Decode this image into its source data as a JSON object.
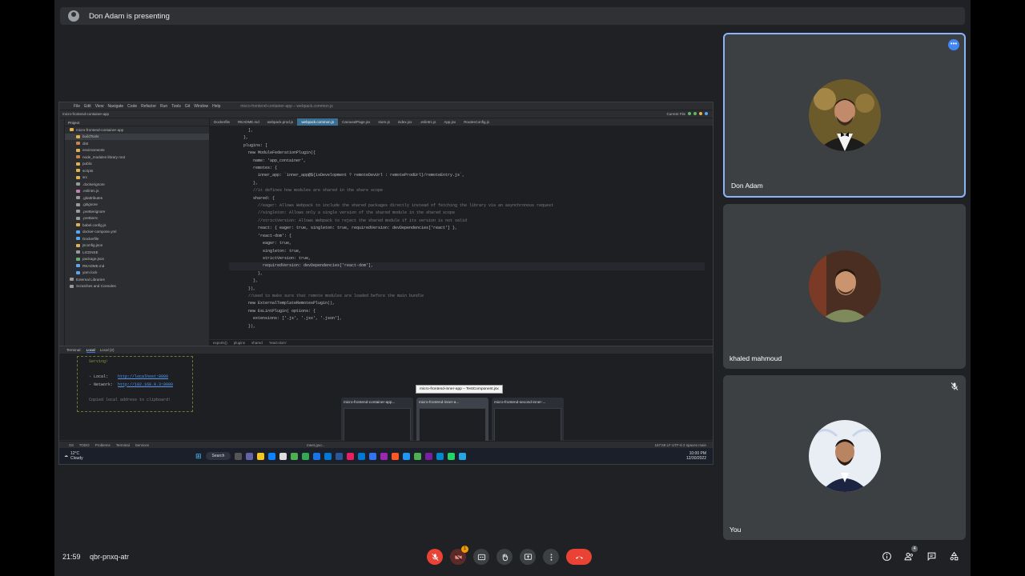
{
  "banner": {
    "text": "Don Adam is presenting"
  },
  "ide": {
    "menu": [
      "File",
      "Edit",
      "View",
      "Navigate",
      "Code",
      "Refactor",
      "Run",
      "Tools",
      "Git",
      "Window",
      "Help"
    ],
    "window_title": "micro-frontend-container-app – webpack.common.js",
    "breadcrumb": "micro-frontend-container-app",
    "run_config": "Current File",
    "project_header": "Project",
    "tree": [
      {
        "label": "micro-frontend-container-app",
        "color": "#e0b24c",
        "sel": false
      },
      {
        "label": "buildTools",
        "color": "#e0b24c",
        "sel": true
      },
      {
        "label": "dist",
        "color": "#c9834b",
        "sel": false
      },
      {
        "label": "environments",
        "color": "#e0b24c",
        "sel": false
      },
      {
        "label": "node_modules  library root",
        "color": "#c9834b",
        "sel": false
      },
      {
        "label": "public",
        "color": "#e0b24c",
        "sel": false
      },
      {
        "label": "scripts",
        "color": "#e0b24c",
        "sel": false
      },
      {
        "label": "src",
        "color": "#e0b24c",
        "sel": false
      },
      {
        "label": ".dockerignore",
        "color": "#999",
        "sel": false
      },
      {
        "label": ".eslintrc.js",
        "color": "#c77dbb",
        "sel": false
      },
      {
        "label": ".gitattributes",
        "color": "#999",
        "sel": false
      },
      {
        "label": ".gitignore",
        "color": "#999",
        "sel": false
      },
      {
        "label": ".prettierignore",
        "color": "#999",
        "sel": false
      },
      {
        "label": ".prettierrc",
        "color": "#999",
        "sel": false
      },
      {
        "label": "babel.config.js",
        "color": "#e0b24c",
        "sel": false
      },
      {
        "label": "docker-compose.yml",
        "color": "#56a8f5",
        "sel": false
      },
      {
        "label": "Dockerfile",
        "color": "#56a8f5",
        "sel": false
      },
      {
        "label": "jsconfig.json",
        "color": "#e0b24c",
        "sel": false
      },
      {
        "label": "LICENSE",
        "color": "#999",
        "sel": false
      },
      {
        "label": "package.json",
        "color": "#6aab73",
        "sel": false
      },
      {
        "label": "README.md",
        "color": "#56a8f5",
        "sel": false
      },
      {
        "label": "yarn.lock",
        "color": "#56a8f5",
        "sel": false
      },
      {
        "label": "External Libraries",
        "color": "#999",
        "sel": false
      },
      {
        "label": "Scratches and Consoles",
        "color": "#999",
        "sel": false
      }
    ],
    "tabs": [
      {
        "label": "Dockerfile",
        "active": false
      },
      {
        "label": "README.md",
        "active": false
      },
      {
        "label": "webpack.prod.js",
        "active": false
      },
      {
        "label": "webpack.common.js",
        "active": true
      },
      {
        "label": "CarouselPage.jsx",
        "active": false
      },
      {
        "label": "store.js",
        "active": false
      },
      {
        "label": "index.jsx",
        "active": false
      },
      {
        "label": ".eslintrc.js",
        "active": false
      },
      {
        "label": "App.jsx",
        "active": false
      },
      {
        "label": "RoutesConfig.js",
        "active": false
      }
    ],
    "code_lines": [
      "        ],",
      "      },",
      "      plugins: [",
      "        new ModuleFederationPlugin({",
      "          name: 'app_container',",
      "          remotes: {",
      "            inner_app: `inner_app@${isDevelopment ? remoteDevUrl : remoteProdUrl}/remoteEntry.js`,",
      "          },",
      "          //it defines how modules are shared in the share scope",
      "          shared: {",
      "            //eager: Allows Webpack to include the shared packages directly instead of fetching the library via an asynchronous request",
      "            //singleton: Allows only a single version of the shared module in the shared scope",
      "            //strictVersion: Allows Webpack to reject the shared module if its version is not valid",
      "            react: { eager: true, singleton: true, requiredVersion: devDependencies['react'] },",
      "            'react-dom': {",
      "              eager: true,",
      "              singleton: true,",
      "              strictVersion: true,",
      "              requiredVersion: devDependencies['react-dom'],",
      "            },",
      "          },",
      "        }),",
      "        //used to make sure that remote modules are loaded before the main bundle",
      "        new ExternalTemplateRemotesPlugin(),",
      "        new EsLintPlugin( options: {",
      "          extensions: ['.js', '.jsx', '.json'],",
      "        }),"
    ],
    "crumbs": [
      "exports()",
      "plugins",
      "shared",
      "'react-dom'"
    ],
    "terminal_tabs": [
      "Terminal:",
      "Local",
      "Local (2)"
    ],
    "terminal": {
      "line1": "  Serving!",
      "local_label": "  - Local:",
      "local_url": "http://localhost:8080",
      "network_label": "  - Network:",
      "network_url": "http://192.168.0.3:8080",
      "copied": "  Copied local address to clipboard!"
    },
    "status_tabs": [
      "Git",
      "TODO",
      "Problems",
      "Terminal",
      "Services"
    ],
    "status_right": "167:59  LF  UTF-8  2 spaces  main",
    "tooltip": "micro-frontend-inner-app – TestComponent.jsx",
    "thumbnails": [
      {
        "label": "micro-frontend-container-app...",
        "sel": false
      },
      {
        "label": "micro-frontend-inner-a...",
        "sel": true
      },
      {
        "label": "micro-frontend-second-inner-...",
        "sel": false
      }
    ],
    "meet_task": "meet.goo..."
  },
  "taskbar": {
    "temp": "12°C",
    "weather": "Cloudy",
    "search": "Search",
    "lang": "ENG\nUS",
    "clock": "10:00 PM",
    "date": "12/30/2022"
  },
  "participants": [
    {
      "name": "Don Adam",
      "active": true
    },
    {
      "name": "khaled mahmoud",
      "active": false
    },
    {
      "name": "You",
      "active": false
    }
  ],
  "meeting": {
    "time": "21:59",
    "code": "qbr-pnxq-atr",
    "chat_badge": "1",
    "people_count": "4"
  },
  "colors": {
    "accent": "#8ab4f8",
    "end_call": "#ea4335",
    "background": "#202124"
  }
}
